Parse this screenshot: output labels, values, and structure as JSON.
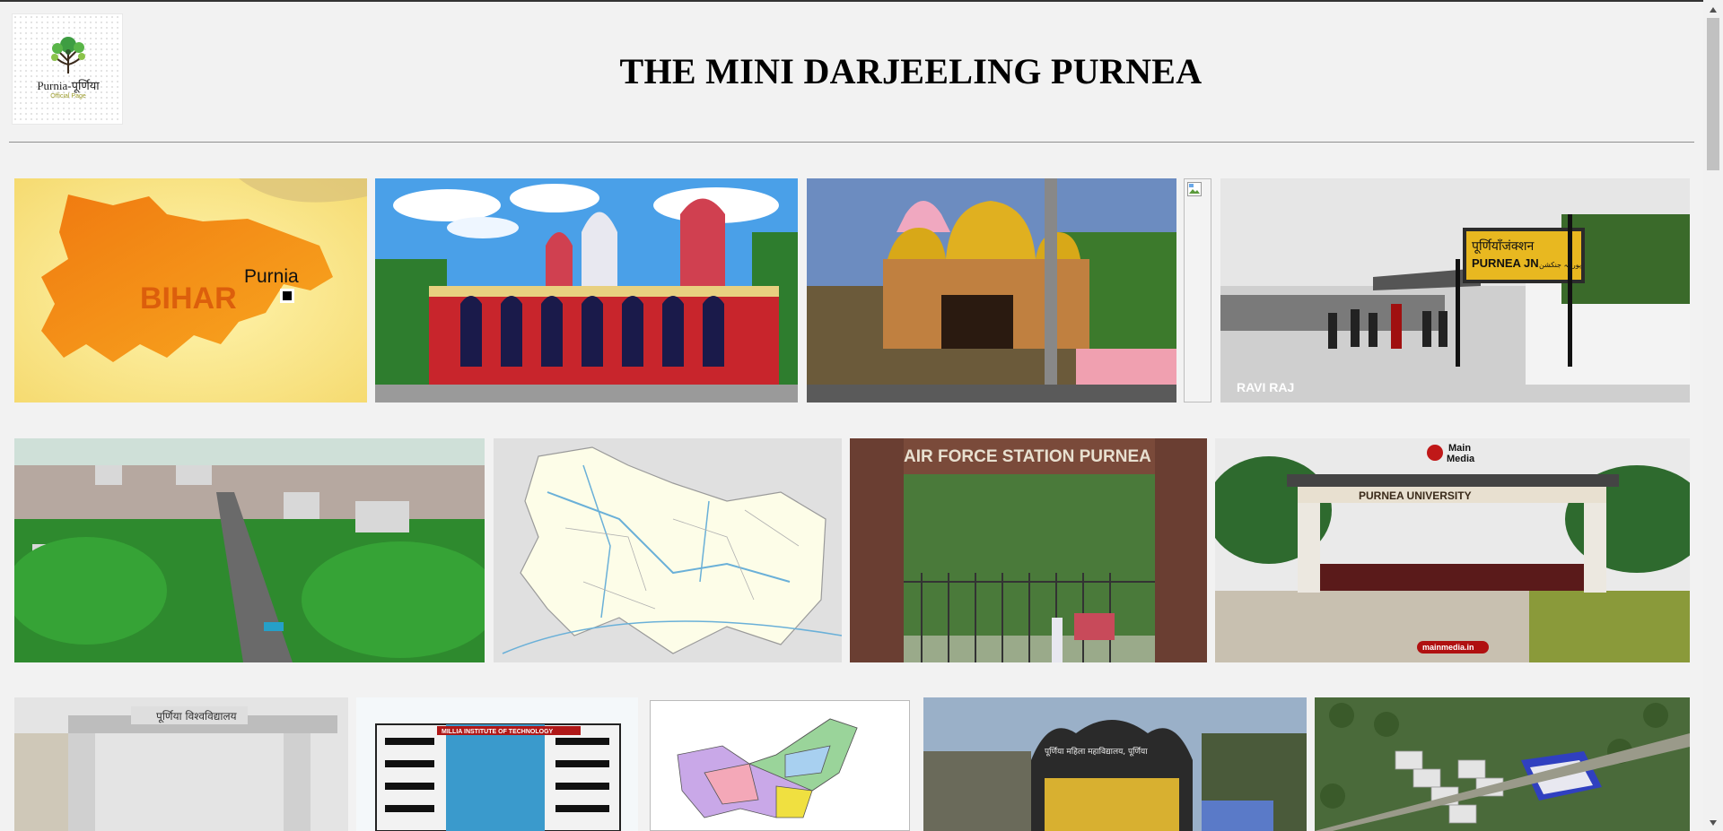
{
  "page": {
    "title": "THE MINI DARJEELING PURNEA",
    "logo": {
      "name": "Purnia-पूर्णिया",
      "tagline": "Official Page",
      "icon": "tree-logo-icon"
    }
  },
  "gallery": {
    "row1": [
      {
        "icon": "bihar-map-image",
        "labels": [
          "BIHAR",
          "Purnia"
        ]
      },
      {
        "icon": "temple-image"
      },
      {
        "icon": "golden-temple-image"
      },
      {
        "icon": "broken-image-icon"
      },
      {
        "icon": "railway-station-image",
        "labels": [
          "पूर्णियाँजंक्शन",
          "PURNEA JN",
          "پورنیہ جنکشن",
          "RAVI RAJ"
        ]
      }
    ],
    "row2": [
      {
        "icon": "aerial-city-image"
      },
      {
        "icon": "district-map-image"
      },
      {
        "icon": "air-force-gate-image",
        "labels": [
          "AIR FORCE STATION PURNEA"
        ]
      },
      {
        "icon": "university-gate-image",
        "labels": [
          "Main",
          "Media",
          "PURNEA UNIVERSITY",
          "mainmedia.in"
        ]
      }
    ],
    "row3": [
      {
        "icon": "university-arch-image",
        "labels": [
          "पूर्णिया विश्वविद्यालय"
        ]
      },
      {
        "icon": "institute-building-image",
        "labels": [
          "MILLIA INSTITUTE OF TECHNOLOGY"
        ]
      },
      {
        "icon": "colored-map-image"
      },
      {
        "icon": "college-gate-image",
        "labels": [
          "पूर्णिया महिला महाविद्यालय, पूर्णिया"
        ]
      },
      {
        "icon": "township-render-image"
      }
    ]
  },
  "colors": {
    "background": "#f2f2f2",
    "rule": "#8f8f8f",
    "text": "#000000"
  }
}
